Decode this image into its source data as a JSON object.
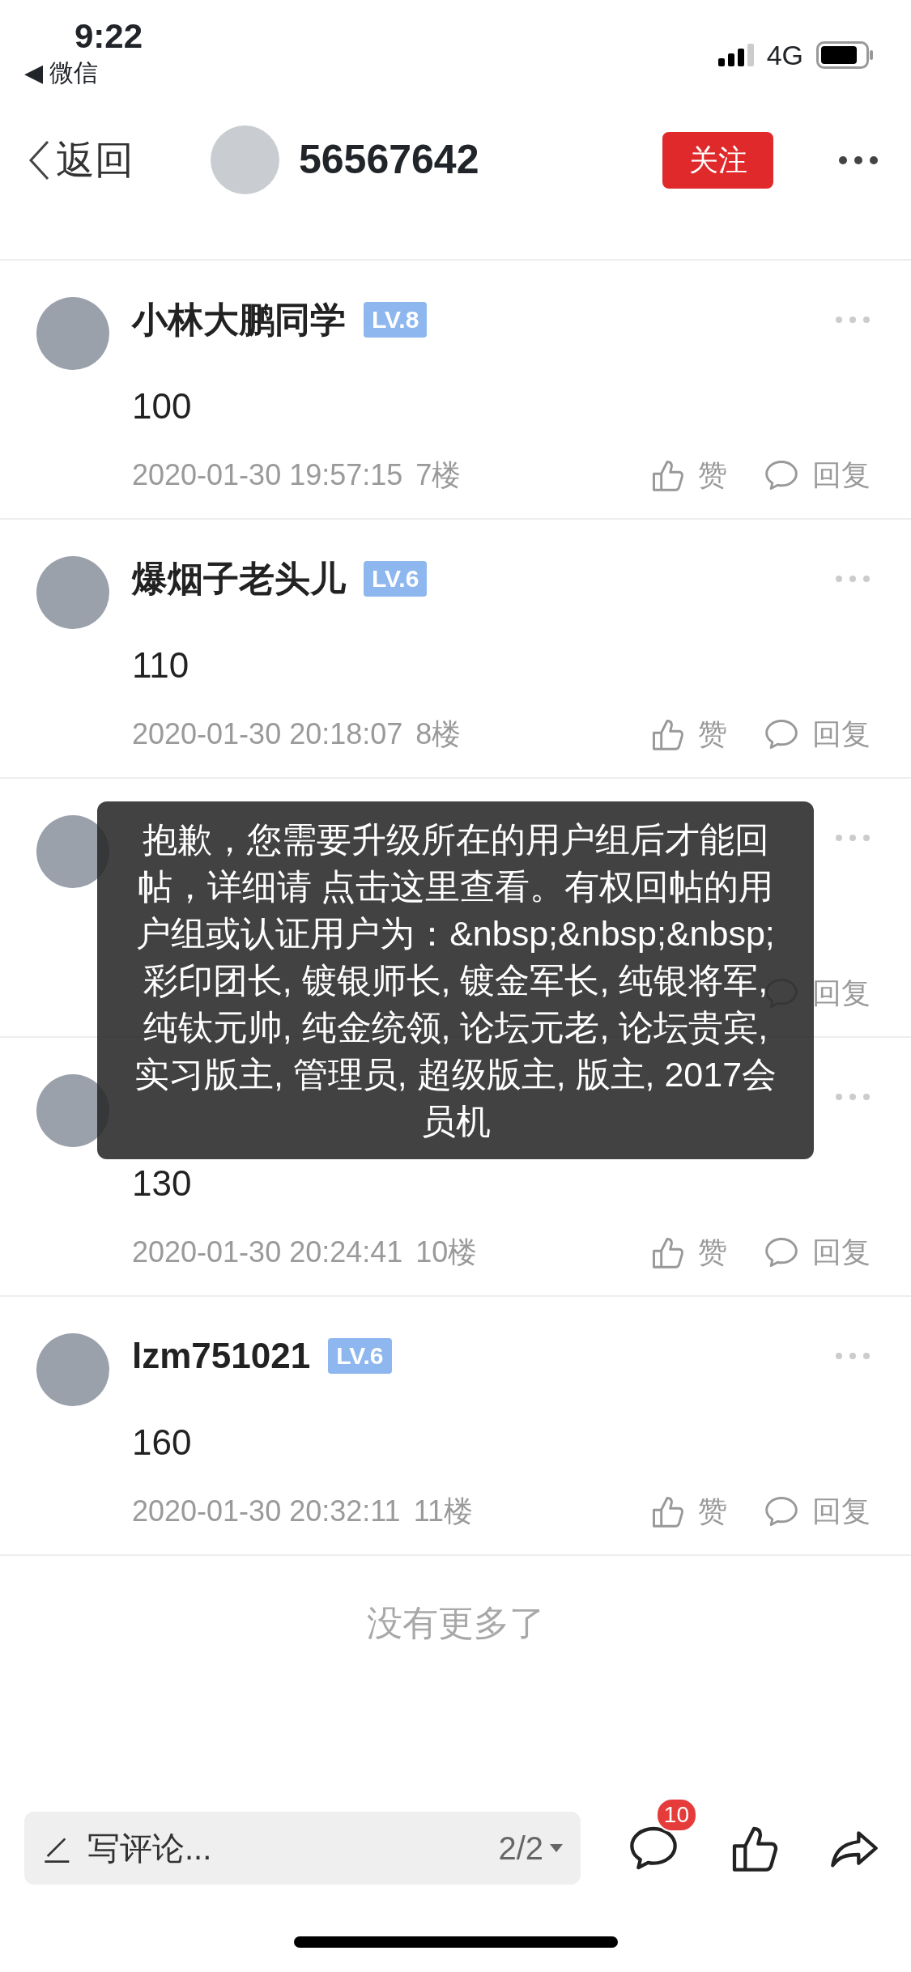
{
  "status_bar": {
    "time": "9:22",
    "back_arrow": "◀",
    "back_app": "微信",
    "network": "4G"
  },
  "header": {
    "back_label": "返回",
    "title": "56567642",
    "follow_label": "关注"
  },
  "comments": [
    {
      "name": "小林大鹏同学",
      "level": "LV.8",
      "content": "100",
      "time": "2020-01-30 19:57:15",
      "floor": "7楼",
      "like_label": "赞",
      "reply_label": "回复"
    },
    {
      "name": "爆烟子老头儿",
      "level": "LV.6",
      "content": "110",
      "time": "2020-01-30 20:18:07",
      "floor": "8楼",
      "like_label": "赞",
      "reply_label": "回复"
    },
    {
      "reply_label": "回复"
    },
    {
      "content": "130",
      "time": "2020-01-30 20:24:41",
      "floor": "10楼",
      "like_label": "赞",
      "reply_label": "回复"
    },
    {
      "name": "lzm751021",
      "level": "LV.6",
      "content": "160",
      "time": "2020-01-30 20:32:11",
      "floor": "11楼",
      "like_label": "赞",
      "reply_label": "回复"
    }
  ],
  "end_note": "没有更多了",
  "toast": {
    "text": "抱歉，您需要升级所在的用户组后才能回帖，详细请 点击这里查看。有权回帖的用户组或认证用户为：&nbsp;&nbsp;&nbsp; 彩印团长, 镀银师长, 镀金军长, 纯银将军, 纯钛元帅, 纯金统领, 论坛元老, 论坛贵宾, 实习版主, 管理员, 超级版主, 版主, 2017会员机"
  },
  "bottom_bar": {
    "placeholder": "写评论...",
    "page": "2/2",
    "comment_count": "10"
  }
}
